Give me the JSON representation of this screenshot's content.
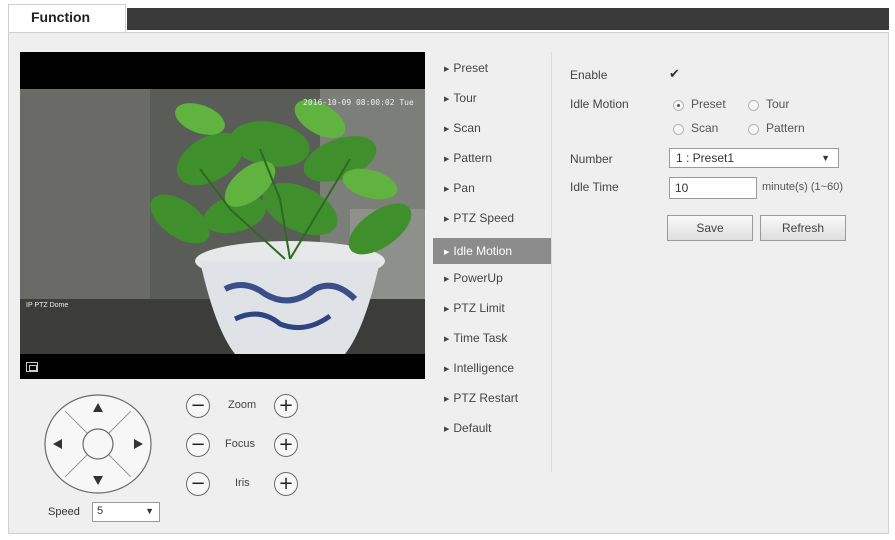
{
  "tab": {
    "title": "Function"
  },
  "video": {
    "timestamp": "2016-10-09 08:00:02 Tue",
    "channel_name": "IP PTZ Dome"
  },
  "ptz": {
    "zoom_label": "Zoom",
    "focus_label": "Focus",
    "iris_label": "Iris",
    "minus_glyph": "−",
    "plus_glyph": "+",
    "speed_label": "Speed",
    "speed_value": "5"
  },
  "menu": {
    "items": [
      {
        "label": "Preset"
      },
      {
        "label": "Tour"
      },
      {
        "label": "Scan"
      },
      {
        "label": "Pattern"
      },
      {
        "label": "Pan"
      },
      {
        "label": "PTZ Speed"
      },
      {
        "label": "Idle Motion"
      },
      {
        "label": "PowerUp"
      },
      {
        "label": "PTZ Limit"
      },
      {
        "label": "Time Task"
      },
      {
        "label": "Intelligence"
      },
      {
        "label": "PTZ Restart"
      },
      {
        "label": "Default"
      }
    ],
    "active": "Idle Motion"
  },
  "form": {
    "enable_label": "Enable",
    "enable_checked": true,
    "check_glyph": "✔",
    "idle_motion_label": "Idle Motion",
    "options": {
      "preset": "Preset",
      "tour": "Tour",
      "scan": "Scan",
      "pattern": "Pattern"
    },
    "selected_option": "Preset",
    "number_label": "Number",
    "number_value": "1 : Preset1",
    "idle_time_label": "Idle Time",
    "idle_time_value": "10",
    "idle_time_unit": "minute(s) (1~60)",
    "save_label": "Save",
    "refresh_label": "Refresh"
  },
  "colors": {
    "active_menu_bg": "#8c8c8c",
    "panel_bg": "#efefef",
    "header_strip": "#3a3a3a"
  }
}
